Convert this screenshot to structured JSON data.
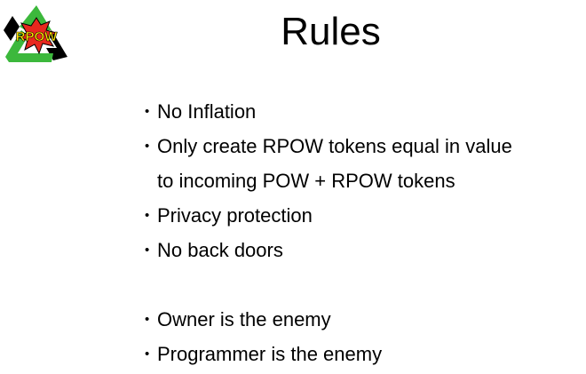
{
  "slide": {
    "title": "Rules",
    "logo_text": "RPOW",
    "bullet_glyph": "•",
    "bullets": [
      "No Inflation",
      "Only create RPOW tokens equal in value",
      "to incoming POW + RPOW tokens",
      "Privacy protection",
      "No back doors",
      "Owner is the enemy",
      "Programmer is the enemy"
    ]
  },
  "colors": {
    "recycle_green": "#3cb83c",
    "recycle_black": "#000000",
    "burst_red": "#e8281e",
    "logo_text_yellow": "#ffe600"
  }
}
